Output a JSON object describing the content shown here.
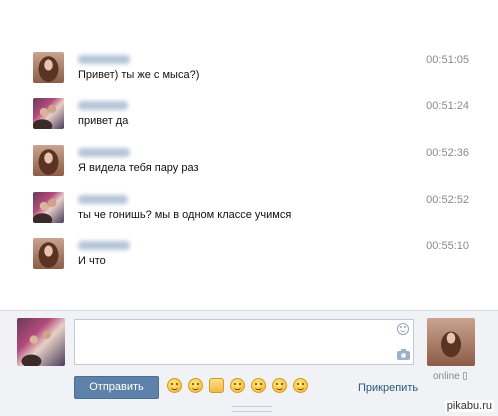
{
  "messages": [
    {
      "sender": "girl",
      "text": "Привет) ты же с мыса?)",
      "time": "00:51:05"
    },
    {
      "sender": "group",
      "text": "привет да",
      "time": "00:51:24"
    },
    {
      "sender": "girl",
      "text": "Я видела тебя пару раз",
      "time": "00:52:36"
    },
    {
      "sender": "group",
      "text": "ты че гонишь? мы в одном классе учимся",
      "time": "00:52:52"
    },
    {
      "sender": "girl",
      "text": "И что",
      "time": "00:55:10"
    }
  ],
  "composer": {
    "message_value": "",
    "send_label": "Отправить",
    "attach_label": "Прикрепить",
    "peer_status": "online",
    "emoji_icons": [
      "laughing-emoji-icon",
      "blushing-emoji-icon",
      "thumbs-up-emoji-icon",
      "smiling-emoji-icon",
      "happy-emoji-icon",
      "sleepy-emoji-icon",
      "grinning-emoji-icon"
    ]
  },
  "watermark": "pikabu.ru",
  "colors": {
    "send_button": "#5d81a8",
    "link": "#2b587a",
    "timestamp": "#8a8a8a",
    "composer_bg": "#f0f2f5"
  }
}
